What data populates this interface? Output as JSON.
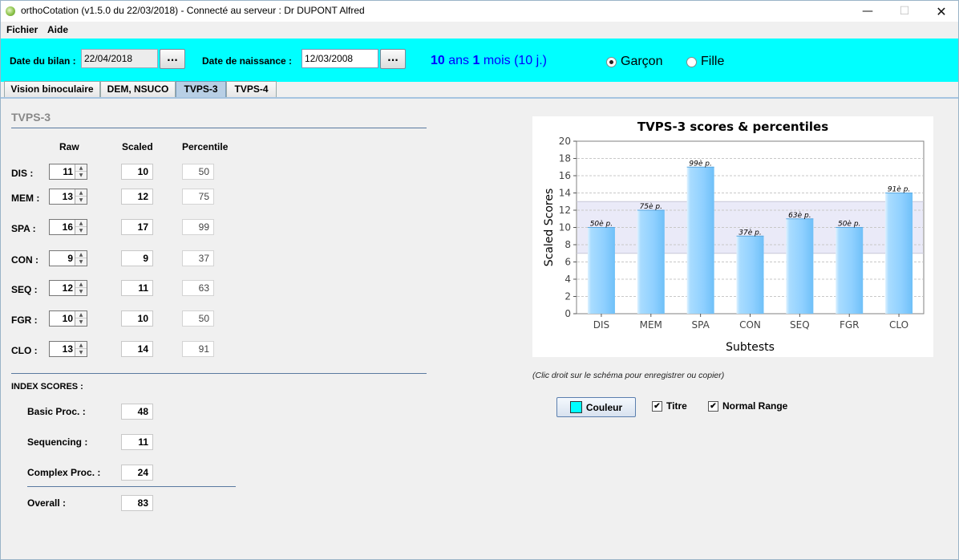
{
  "window": {
    "title": "orthoCotation (v1.5.0 du 22/03/2018) - Connecté au serveur : Dr DUPONT Alfred",
    "minimize": "—",
    "maximize": "☐",
    "close": "✕"
  },
  "menu": {
    "file": "Fichier",
    "help": "Aide"
  },
  "header": {
    "exam_date_label": "Date du bilan :",
    "exam_date": "22/04/2018",
    "birth_date_label": "Date de naissance :",
    "birth_date": "12/03/2008",
    "dots": "...",
    "age": {
      "years": "10",
      "years_label": " ans ",
      "months": "1",
      "months_label": " mois (10 j.)"
    },
    "gender_boy": "Garçon",
    "gender_girl": "Fille"
  },
  "tabs": [
    "Vision binoculaire",
    "DEM, NSUCO",
    "TVPS-3",
    "TVPS-4"
  ],
  "tvps": {
    "title": "TVPS-3",
    "col_raw": "Raw",
    "col_scaled": "Scaled",
    "col_percentile": "Percentile",
    "rows": [
      {
        "label": "DIS :",
        "raw": "11",
        "scaled": "10",
        "percentile": "50"
      },
      {
        "label": "MEM :",
        "raw": "13",
        "scaled": "12",
        "percentile": "75"
      },
      {
        "label": "SPA :",
        "raw": "16",
        "scaled": "17",
        "percentile": "99"
      },
      {
        "label": "CON :",
        "raw": "9",
        "scaled": "9",
        "percentile": "37"
      },
      {
        "label": "SEQ :",
        "raw": "12",
        "scaled": "11",
        "percentile": "63"
      },
      {
        "label": "FGR :",
        "raw": "10",
        "scaled": "10",
        "percentile": "50"
      },
      {
        "label": "CLO :",
        "raw": "13",
        "scaled": "14",
        "percentile": "91"
      }
    ],
    "spin_up": "▲",
    "spin_down": "▼"
  },
  "index": {
    "title": "INDEX SCORES :",
    "basic_label": "Basic Proc. :",
    "basic": "48",
    "seq_label": "Sequencing :",
    "seq": "11",
    "complex_label": "Complex Proc. :",
    "complex": "24",
    "overall_label": "Overall :",
    "overall": "83"
  },
  "chart_data": {
    "type": "bar",
    "title": "TVPS-3 scores & percentiles",
    "xlabel": "Subtests",
    "ylabel": "Scaled Scores",
    "categories": [
      "DIS",
      "MEM",
      "SPA",
      "CON",
      "SEQ",
      "FGR",
      "CLO"
    ],
    "values": [
      10,
      12,
      17,
      9,
      11,
      10,
      14
    ],
    "labels": [
      "50è p.",
      "75è p.",
      "99è p.",
      "37è p.",
      "63è p.",
      "50è p.",
      "91è p."
    ],
    "ylim": [
      0,
      20
    ],
    "yticks": [
      0,
      2,
      4,
      6,
      8,
      10,
      12,
      14,
      16,
      18,
      20
    ],
    "normal_range": [
      7,
      13
    ],
    "grid": true,
    "bar_color": "#8fd0ff",
    "range_color": "#eaeaf8"
  },
  "controls": {
    "note": "(Clic droit sur le schéma pour enregistrer ou copier)",
    "color_button": "Couleur",
    "title_check": "Titre",
    "range_check": "Normal Range",
    "check_mark": "✔"
  }
}
